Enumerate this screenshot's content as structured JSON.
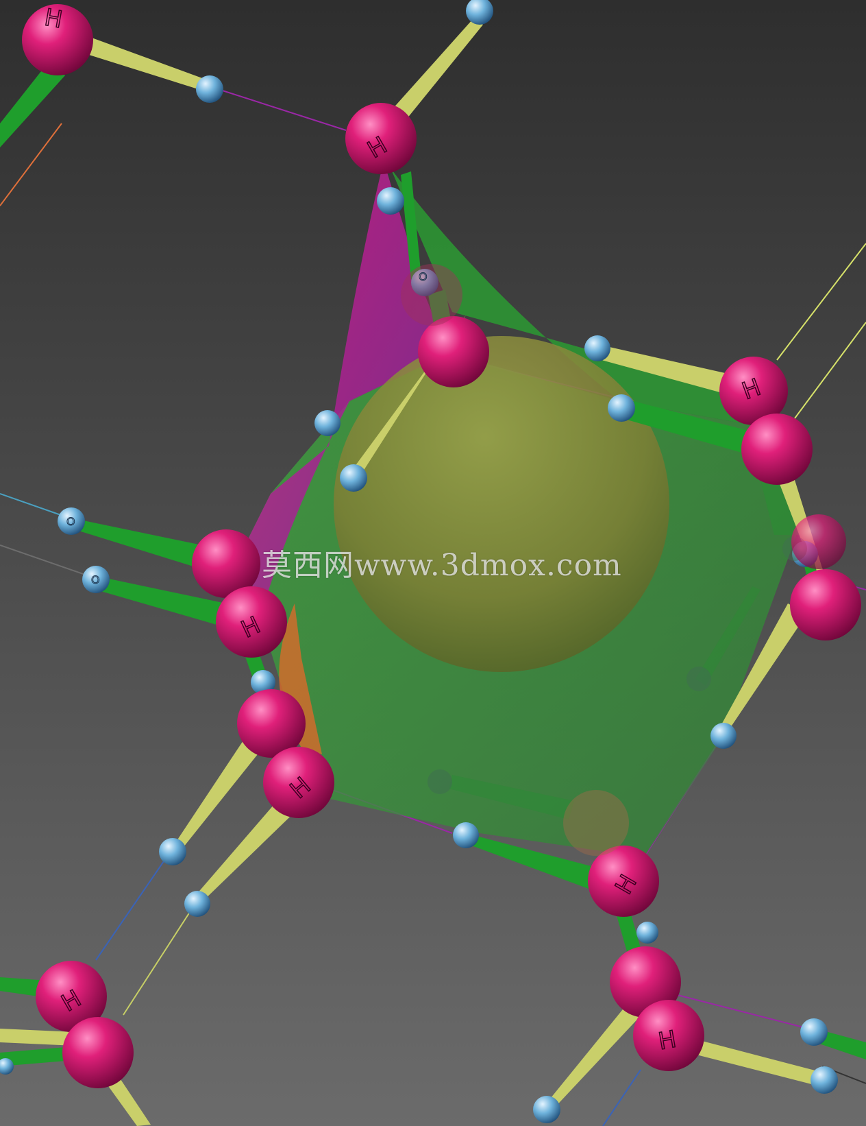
{
  "watermark": {
    "text": "莫西网www.3dmox.com"
  },
  "atom_labels": {
    "large": "H",
    "small": "O"
  },
  "colors": {
    "background_top": "#2e2e2e",
    "background_bottom": "#6b6b6b",
    "large_atom": "#d8166f",
    "small_atom": "#6fb3dc",
    "bond_green": "#1f9e2c",
    "bond_olive": "#c9cf6a",
    "cage_face": "#3c9c3c",
    "cage_face_magenta": "#b0157a",
    "guest_sphere": "#8a8d3c"
  }
}
